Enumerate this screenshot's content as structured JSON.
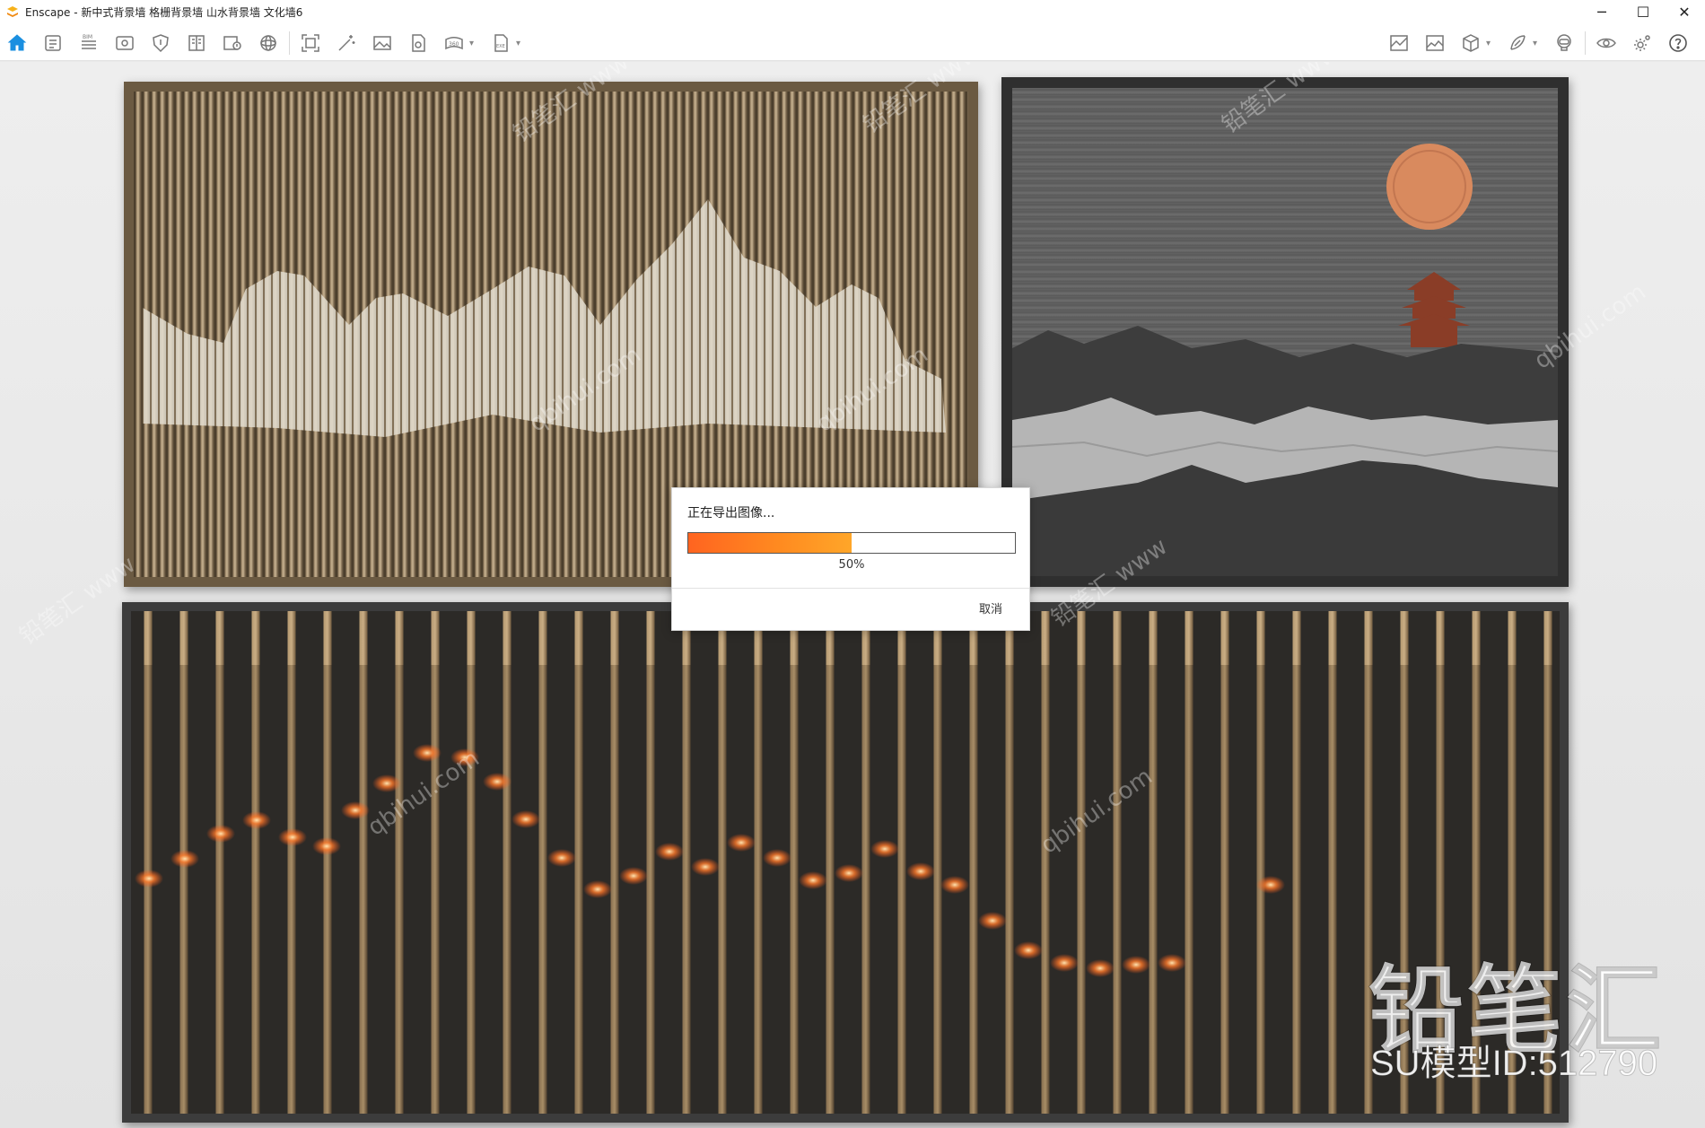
{
  "app": {
    "title": "Enscape - 新中式背景墙 格栅背景墙 山水背景墙 文化墙6",
    "logo_icon": "enscape-logo-icon",
    "accent_color": "#1a8fe0"
  },
  "window_controls": [
    {
      "name": "minimize-icon",
      "glyph": "─"
    },
    {
      "name": "maximize-icon",
      "glyph": "☐"
    },
    {
      "name": "close-icon",
      "glyph": "✕"
    }
  ],
  "toolbar": {
    "left_icons": [
      "home-icon",
      "document-icon",
      "bim-icon",
      "view-icon",
      "shield-icon",
      "book-icon",
      "map-info-icon",
      "sphere-icon"
    ],
    "mid_icons": [
      "frame-icon",
      "magic-wand-icon",
      "image-icon",
      "file-icon",
      "panorama-360-icon",
      "exe-export-icon"
    ],
    "right_icons": [
      "image-compare-icon",
      "landscape-icon",
      "cube-icon",
      "feather-icon",
      "vr-headset-icon",
      "eye-icon",
      "settings-icon",
      "help-icon"
    ]
  },
  "watermark": {
    "brand": "铅笔汇",
    "model_id": "SU模型ID:512790",
    "repeat_texts": [
      "铅笔汇 www",
      "qbihui.com"
    ]
  },
  "export_dialog": {
    "message": "正在导出图像...",
    "progress_percent": 50,
    "progress_label": "50%",
    "cancel_label": "取消"
  }
}
